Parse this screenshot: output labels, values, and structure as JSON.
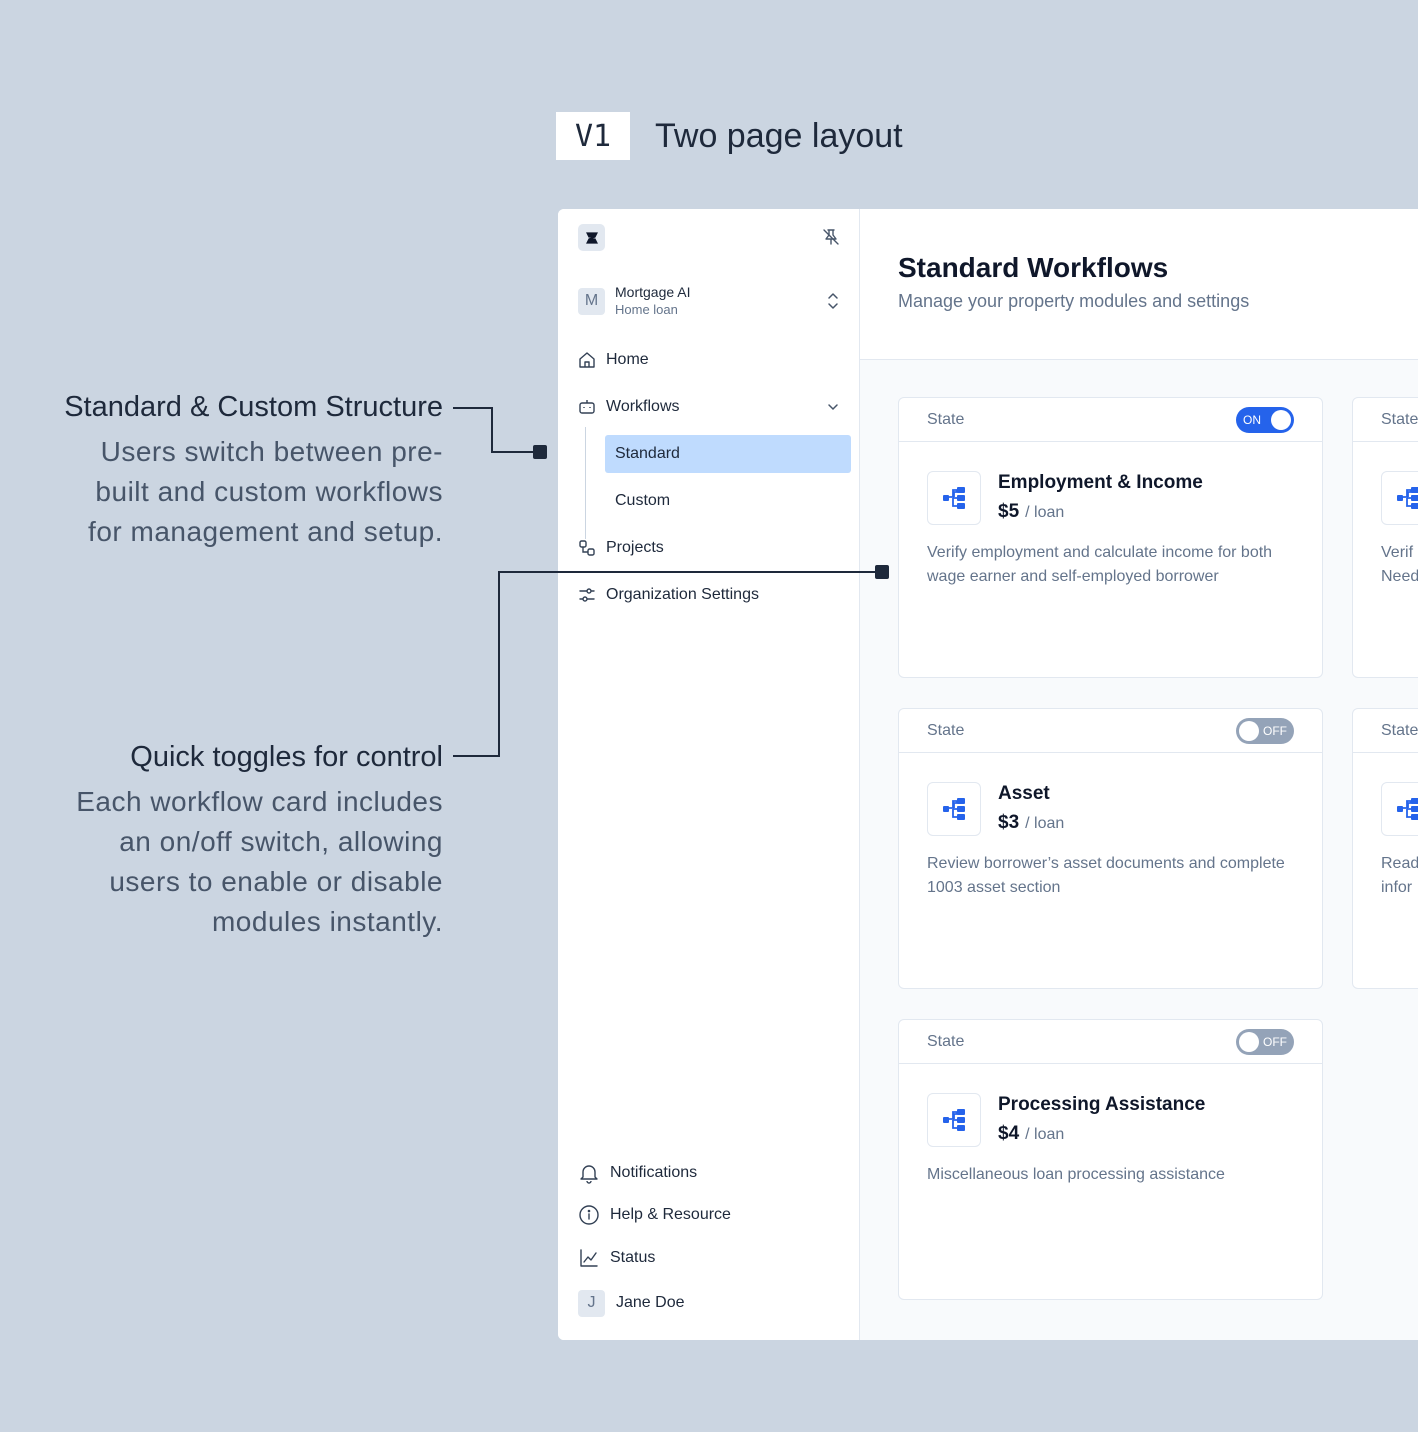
{
  "heading": {
    "version": "V1",
    "title": "Two page layout"
  },
  "annotations": [
    {
      "title": "Standard & Custom Structure",
      "lines": [
        "Users switch between pre-",
        "built and custom workflows",
        "for management and setup."
      ]
    },
    {
      "title": "Quick toggles for control",
      "lines": [
        "Each workflow card includes",
        "an on/off switch, allowing",
        "users to enable or disable",
        "modules instantly."
      ]
    }
  ],
  "sidebar": {
    "org": {
      "initial": "M",
      "name": "Mortgage AI",
      "subtitle": "Home loan"
    },
    "nav": {
      "home": "Home",
      "workflows": "Workflows",
      "standard": "Standard",
      "custom": "Custom",
      "projects": "Projects",
      "org_settings": "Organization Settings"
    },
    "bottom": {
      "notifications": "Notifications",
      "help": "Help & Resource",
      "status": "Status",
      "user_initial": "J",
      "user_name": "Jane Doe"
    }
  },
  "main": {
    "title": "Standard Workflows",
    "subtitle": "Manage your property modules and settings",
    "cards": [
      {
        "state_label": "State",
        "toggle": "ON",
        "title": "Employment & Income",
        "price": "$5",
        "per": "/ loan",
        "desc": "Verify employment and calculate income for both wage earner and self-employed borrower"
      },
      {
        "state_label": "State",
        "toggle": "OFF",
        "title": "Asset",
        "price": "$3",
        "per": "/ loan",
        "desc": "Review borrower’s asset documents and complete 1003 asset section"
      },
      {
        "state_label": "State",
        "toggle": "OFF",
        "title": "Processing Assistance",
        "price": "$4",
        "per": "/ loan",
        "desc": "Miscellaneous loan processing assistance"
      }
    ],
    "partial_cards": [
      {
        "state_label": "State",
        "desc": "Verif Need"
      },
      {
        "state_label": "State",
        "desc": "Read infor"
      }
    ]
  },
  "colors": {
    "accent": "#2563eb",
    "background": "#cbd5e1",
    "selected": "#bfdbfe"
  }
}
